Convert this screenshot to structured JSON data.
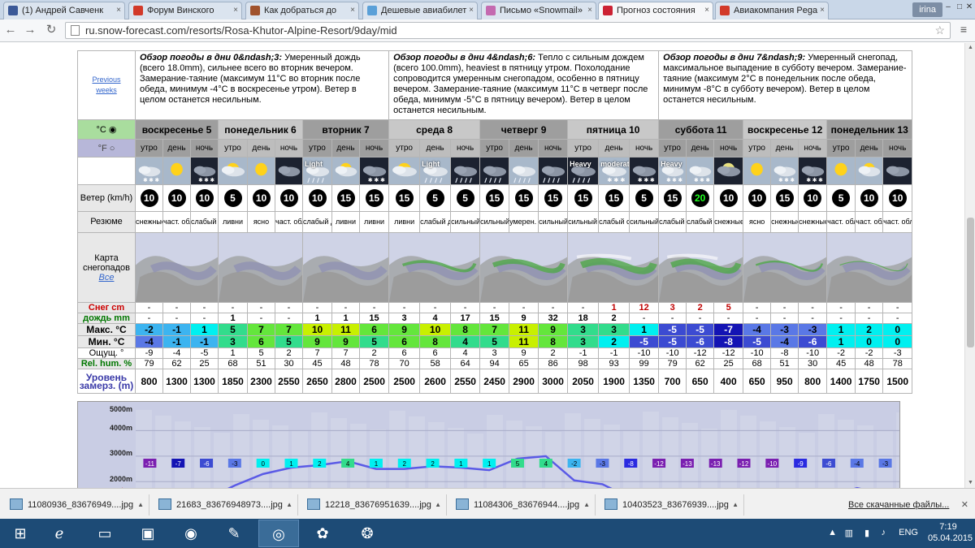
{
  "browser": {
    "tabs": [
      {
        "label": "(1) Андрей Савченк",
        "color": "#3b5998"
      },
      {
        "label": "Форум Винского",
        "color": "#d23a2a"
      },
      {
        "label": "Как добраться до",
        "color": "#a0522d"
      },
      {
        "label": "Дешевые авиабилет",
        "color": "#5aa0d8"
      },
      {
        "label": "Письмо «Snowmail»",
        "color": "#c46ab0"
      },
      {
        "label": "Прогноз состояния",
        "color": "#cc2233",
        "active": true
      },
      {
        "label": "Авиакомпания Pegа",
        "color": "#d23a2a"
      }
    ],
    "user": "irina",
    "url": "ru.snow-forecast.com/resorts/Rosa-Khutor-Alpine-Resort/9day/mid"
  },
  "forecast": {
    "prev_label": "Previous weeks",
    "summaries": [
      {
        "title": "Обзор погоды в дни 0&ndash;3:",
        "text": "Умеренный дождь (всего 18.0mm), сильнее всего во вторник вечером. Замерание-таяние (максимум 11°C во вторник после обеда, минимум -4°C в воскресенье утром). Ветер в целом останется несильным."
      },
      {
        "title": "Обзор погоды в дни 4&ndash;6:",
        "text": "Тепло с сильным дождем (всего 100.0mm), heaviest в пятницу утром. Похолодание сопроводится умеренным снегопадом, особенно в пятницу вечером. Замерание-таяние (максимум 11°C в четверг после обеда, минимум -5°C в пятницу вечером). Ветер в целом останется несильным."
      },
      {
        "title": "Обзор погоды в дни 7&ndash;9:",
        "text": "Умеренный снегопад, максимальное выпадение в субботу вечером. Замерание-таяние (максимум 2°C в понедельник после обеда, минимум -8°C в субботу вечером). Ветер в целом останется несильным."
      }
    ],
    "unit_c": "°C",
    "unit_f": "°F",
    "days": [
      "воскресенье 5",
      "понедельник 6",
      "вторник 7",
      "среда 8",
      "четверг 9",
      "пятница 10",
      "суббота 11",
      "воскресенье 12",
      "понедельник 13"
    ],
    "periods": [
      "утро",
      "день",
      "ночь"
    ],
    "labels": {
      "wind": "Ветер (km/h)",
      "summary": "Резюме",
      "map": "Карта снегопадов",
      "map_link": "Все",
      "snow": "Снег cm",
      "rain": "дождь mm",
      "max": "Макс. °C",
      "min": "Мин. °C",
      "feels": "Ощущ. °",
      "hum": "Rel. hum. %",
      "freeze": "Уровень замерз. (m)"
    },
    "icon_labels": [
      "",
      "",
      "",
      "",
      "",
      "",
      "Light",
      "",
      "",
      "",
      "Light",
      "",
      "",
      "",
      "",
      "Heavy",
      "moderate",
      "",
      "Heavy",
      "",
      "",
      "",
      "",
      "",
      "",
      "",
      "",
      "",
      "",
      "",
      "",
      "",
      "",
      ""
    ],
    "wind": [
      "10",
      "10",
      "10",
      "5",
      "10",
      "10",
      "10",
      "15",
      "15",
      "15",
      "5",
      "5",
      "15",
      "15",
      "15",
      "15",
      "15",
      "5",
      "15",
      "20",
      "10",
      "10",
      "15",
      "10",
      "5",
      "10",
      "10"
    ],
    "desc": [
      "снежные ливни",
      "част. облач.",
      "слабый снег",
      "ливни",
      "ясно",
      "част. облач.",
      "слабый дождь",
      "ливни",
      "ливни",
      "ливни",
      "слабый дождь",
      "сильный дождь",
      "сильный дождь",
      "умерен. дождь",
      "сильный дождь",
      "сильный дождь",
      "слабый снег",
      "сильный снег",
      "слабый снег",
      "слабый снег",
      "снежные ливни",
      "ясно",
      "снежные ливни",
      "снежные ливни",
      "част. облач.",
      "част. облач.",
      "част. облач."
    ],
    "snow": [
      "-",
      "-",
      "-",
      "-",
      "-",
      "-",
      "-",
      "-",
      "-",
      "-",
      "-",
      "-",
      "-",
      "-",
      "-",
      "-",
      "1",
      "12",
      "3",
      "2",
      "5",
      "-",
      "-",
      "-",
      "-",
      "-",
      "-"
    ],
    "rain": [
      "-",
      "-",
      "-",
      "1",
      "-",
      "-",
      "1",
      "1",
      "15",
      "3",
      "4",
      "17",
      "15",
      "9",
      "32",
      "18",
      "2",
      "-",
      "-",
      "-",
      "-",
      "-",
      "-",
      "-",
      "-",
      "-",
      "-"
    ],
    "tmax": [
      "-2",
      "-1",
      "1",
      "5",
      "7",
      "7",
      "10",
      "11",
      "6",
      "9",
      "10",
      "8",
      "7",
      "11",
      "9",
      "3",
      "3",
      "1",
      "-5",
      "-5",
      "-7",
      "-4",
      "-3",
      "-3",
      "1",
      "2",
      "0"
    ],
    "tmin": [
      "-4",
      "-1",
      "-1",
      "3",
      "6",
      "5",
      "9",
      "9",
      "5",
      "6",
      "8",
      "4",
      "5",
      "11",
      "8",
      "3",
      "2",
      "-5",
      "-5",
      "-6",
      "-8",
      "-5",
      "-4",
      "-6",
      "1",
      "0",
      "0"
    ],
    "feels": [
      "-9",
      "-4",
      "-5",
      "1",
      "5",
      "2",
      "7",
      "7",
      "2",
      "6",
      "6",
      "4",
      "3",
      "9",
      "2",
      "-1",
      "-1",
      "-10",
      "-10",
      "-12",
      "-12",
      "-10",
      "-8",
      "-10",
      "-2",
      "-2",
      "-3"
    ],
    "hum": [
      "79",
      "62",
      "25",
      "68",
      "51",
      "30",
      "45",
      "48",
      "78",
      "70",
      "58",
      "64",
      "94",
      "65",
      "86",
      "98",
      "93",
      "99",
      "79",
      "62",
      "25",
      "68",
      "51",
      "30",
      "45",
      "48",
      "78"
    ],
    "freeze": [
      "800",
      "1300",
      "1300",
      "1850",
      "2300",
      "2550",
      "2650",
      "2800",
      "2500",
      "2500",
      "2600",
      "2550",
      "2450",
      "2900",
      "3000",
      "2050",
      "1900",
      "1350",
      "700",
      "650",
      "400",
      "650",
      "950",
      "800",
      "1400",
      "1750",
      "1500"
    ],
    "colors": {
      "accent_green": "#a9dd9e",
      "header": "#c8c8c8"
    }
  },
  "chart": {
    "axis": [
      "5000m",
      "4000m",
      "3000m",
      "2000m",
      "top"
    ],
    "chart_data": {
      "type": "line",
      "ylim": [
        1500,
        5000
      ],
      "top_temp": [
        "-11",
        "-7",
        "-6",
        "-3",
        "0",
        "1",
        "2",
        "4",
        "1",
        "2",
        "2",
        "1",
        "1",
        "5",
        "4",
        "-2",
        "-3",
        "-8",
        "-12",
        "-13",
        "-13",
        "-12",
        "-10",
        "-9",
        "-6",
        "-4",
        "-3"
      ],
      "freezing_level": [
        800,
        1300,
        1300,
        1850,
        2300,
        2550,
        2650,
        2800,
        2500,
        2500,
        2600,
        2550,
        2450,
        2900,
        3000,
        2050,
        1900,
        1350,
        700,
        650,
        400,
        650,
        950,
        800,
        1400,
        1750,
        1500
      ]
    }
  },
  "downloads": {
    "items": [
      "11080936_83676949....jpg",
      "21683_83676948973....jpg",
      "12218_83676951639....jpg",
      "11084306_83676944....jpg",
      "10403523_83676939....jpg"
    ],
    "all": "Все скачанные файлы..."
  },
  "taskbar": {
    "lang": "ENG",
    "time": "7:19",
    "date": "05.04.2015"
  }
}
